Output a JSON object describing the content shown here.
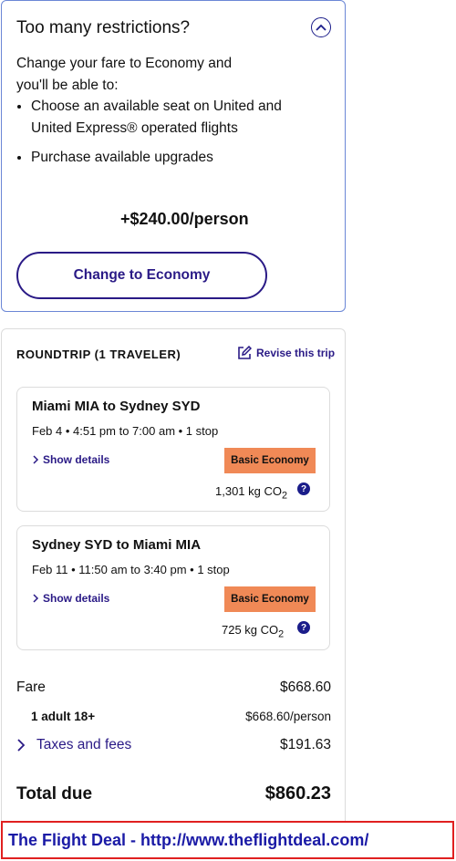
{
  "upsell": {
    "title": "Too many restrictions?",
    "intro": "Change your fare to Economy and you'll be able to:",
    "bullets": [
      "Choose an available seat on United and United Express® operated flights",
      "Purchase available upgrades"
    ],
    "price": "+$240.00/person",
    "button_label": "Change to Economy",
    "collapse_icon": "chevron-up-icon"
  },
  "trip": {
    "header": "ROUNDTRIP (1 TRAVELER)",
    "revise_label": "Revise this trip",
    "revise_icon": "edit-icon",
    "flights": [
      {
        "route": "Miami MIA to Sydney SYD",
        "times": "Feb 4 • 4:51 pm to 7:00 am • 1 stop",
        "details_label": "Show details",
        "fare_class": "Basic Economy",
        "co2": "1,301 kg CO",
        "co2_sub": "2",
        "help": "?"
      },
      {
        "route": "Sydney SYD to Miami MIA",
        "times": "Feb 11 • 11:50 am to 3:40 pm • 1 stop",
        "details_label": "Show details",
        "fare_class": "Basic Economy",
        "co2": "725 kg CO",
        "co2_sub": "2",
        "help": "?"
      }
    ]
  },
  "pricing": {
    "fare_label": "Fare",
    "fare_value": "$668.60",
    "adult_label": "1 adult 18+",
    "adult_value": "$668.60/person",
    "taxes_label": "Taxes and fees",
    "taxes_value": "$191.63",
    "total_label": "Total due",
    "total_value": "$860.23"
  },
  "footer": {
    "text": "The Flight Deal - http://www.theflightdeal.com/"
  },
  "colors": {
    "accent": "#2a1a86",
    "badge": "#f08956",
    "footer_border": "#e02020",
    "footer_text": "#1a1aa6"
  }
}
